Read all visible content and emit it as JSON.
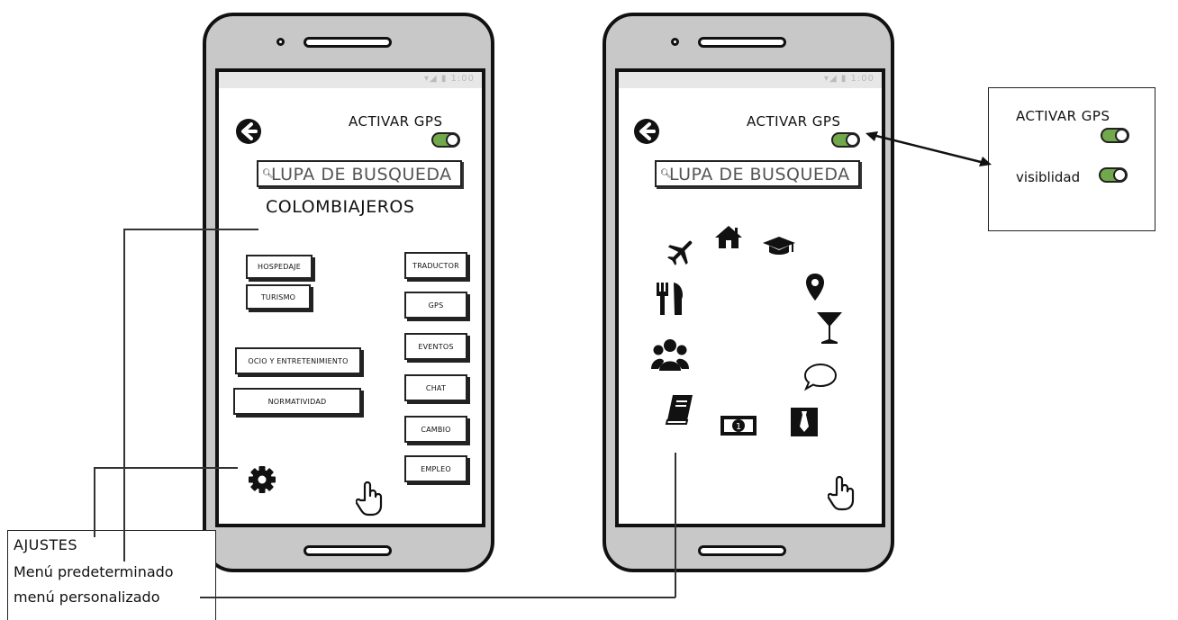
{
  "left_phone": {
    "activar_gps": "ACTIVAR GPS",
    "search_placeholder": "LUPA DE BUSQUEDA",
    "app_title": "COLOMBIAJEROS",
    "left_buttons": [
      "HOSPEDAJE",
      "TURISMO",
      "OCIO Y ENTRETENIMIENTO",
      "NORMATIVIDAD"
    ],
    "right_buttons": [
      "TRADUCTOR",
      "GPS",
      "EVENTOS",
      "CHAT",
      "CAMBIO",
      "EMPLEO"
    ]
  },
  "right_phone": {
    "activar_gps": "ACTIVAR GPS",
    "search_placeholder": "LUPA DE BUSQUEDA",
    "menu_icons": [
      "plane-icon",
      "home-icon",
      "graduation-cap-icon",
      "map-marker-icon",
      "restaurant-icon",
      "cocktail-icon",
      "users-icon",
      "chat-bubble-icon",
      "book-icon",
      "money-icon",
      "tie-icon"
    ]
  },
  "callout": {
    "activar_gps": "ACTIVAR GPS",
    "visibilidad": "visiblidad"
  },
  "legend": {
    "ajustes": "AJUSTES",
    "menu_predeterminado": "Menú predeterminado",
    "menu_personalizado": "menú personalizado"
  },
  "colors": {
    "toggle_on": "#71a84c",
    "phone_body": "#c8c8c8"
  }
}
